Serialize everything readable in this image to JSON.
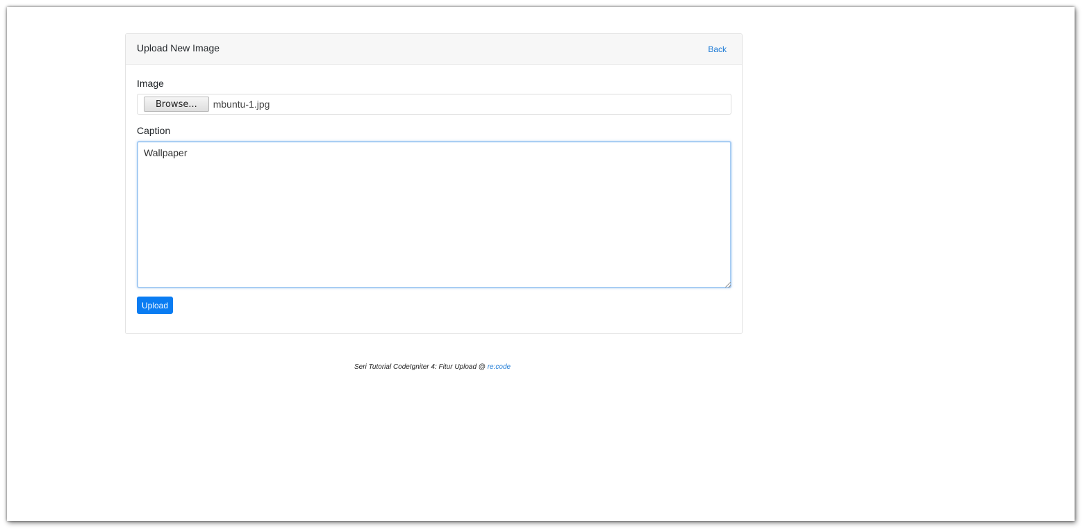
{
  "card": {
    "title": "Upload New Image",
    "back_label": "Back"
  },
  "image_field": {
    "label": "Image",
    "browse_label": "Browse...",
    "file_name": "mbuntu-1.jpg"
  },
  "caption_field": {
    "label": "Caption",
    "value": "Wallpaper"
  },
  "upload_button": {
    "label": "Upload"
  },
  "footer": {
    "text": "Seri Tutorial CodeIgniter 4: Fitur Upload @ ",
    "link_label": "re:code"
  },
  "colors": {
    "accent": "#0a7cf2",
    "link": "#1e7bd6",
    "focus_border": "#a8cdf3"
  }
}
